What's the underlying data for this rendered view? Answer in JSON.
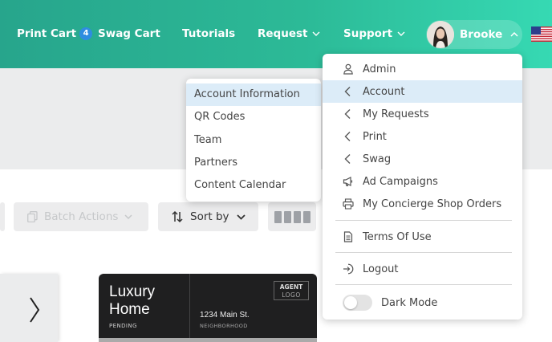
{
  "nav": {
    "print_cart": "Print Cart",
    "print_cart_count": "4",
    "swag_cart": "Swag Cart",
    "tutorials": "Tutorials",
    "request": "Request",
    "support": "Support",
    "user_name": "Brooke",
    "flag": "us-flag-icon"
  },
  "toolbar": {
    "batch_actions": "Batch Actions",
    "sort_by": "Sort by"
  },
  "product_card": {
    "title_line1": "Luxury",
    "title_line2": "Home",
    "status": "PENDING",
    "address": "1234 Main St.",
    "neighborhood": "NEIGHBORHOOD",
    "logo_line1": "AGENT",
    "logo_line2": "LOGO"
  },
  "account_submenu": {
    "items": [
      "Account Information",
      "QR Codes",
      "Team",
      "Partners",
      "Content Calendar"
    ],
    "active_index": 0
  },
  "user_menu": {
    "items": [
      {
        "label": "Admin",
        "icon": "user-icon"
      },
      {
        "label": "Account",
        "icon": "chevron-left-icon"
      },
      {
        "label": "My Requests",
        "icon": "chevron-left-icon"
      },
      {
        "label": "Print",
        "icon": "chevron-left-icon"
      },
      {
        "label": "Swag",
        "icon": "chevron-left-icon"
      },
      {
        "label": "Ad Campaigns",
        "icon": "megaphone-icon"
      },
      {
        "label": "My Concierge Shop Orders",
        "icon": "printer-icon"
      }
    ],
    "terms": "Terms Of Use",
    "logout": "Logout",
    "dark_mode": "Dark Mode",
    "dark_mode_on": false,
    "active_item": "Account"
  },
  "colors": {
    "header_gradient_start": "#27a58c",
    "header_gradient_end": "#36d9b3",
    "active_menu_bg": "#dcecf8",
    "badge_blue": "#2e8de0"
  }
}
